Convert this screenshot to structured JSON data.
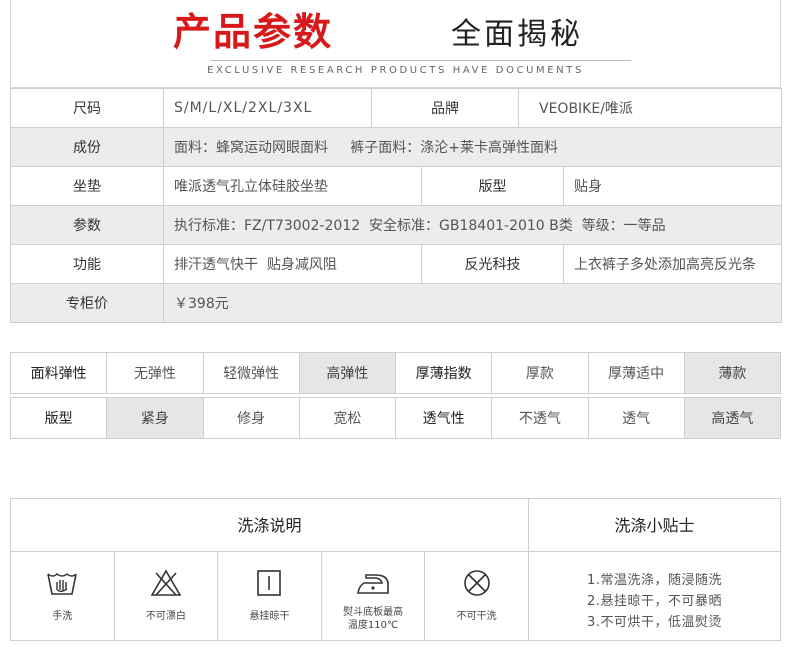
{
  "banner": {
    "title_red": "产品参数",
    "title_black": "全面揭秘",
    "subtitle": "EXCLUSIVE RESEARCH PRODUCTS HAVE DOCUMENTS"
  },
  "specs": {
    "size_label": "尺码",
    "size_value": "S/M/L/XL/2XL/3XL",
    "brand_label": "品牌",
    "brand_value": "VEOBIKE/唯派",
    "material_label": "成份",
    "material_value": "面料：蜂窝运动网眼面料     裤子面料：涤沦+莱卡高弹性面料",
    "pad_label": "坐垫",
    "pad_value": "唯派透气孔立体硅胶坐垫",
    "fit_label": "版型",
    "fit_value": "贴身",
    "params_label": "参数",
    "params_value": "执行标准：FZ/T73002-2012  安全标准：GB18401-2010 B类  等级：一等品",
    "function_label": "功能",
    "function_value": "排汗透气快干  贴身减风阻",
    "reflect_label": "反光科技",
    "reflect_value": "上衣裤子多处添加高亮反光条",
    "price_label": "专柜价",
    "price_value": "￥398元"
  },
  "attributes": {
    "row1": [
      "面料弹性",
      "无弹性",
      "轻微弹性",
      "高弹性",
      "厚薄指数",
      "厚款",
      "厚薄适中",
      "薄款"
    ],
    "row2": [
      "版型",
      "紧身",
      "修身",
      "宽松",
      "透气性",
      "不透气",
      "透气",
      "高透气"
    ]
  },
  "wash": {
    "title": "洗涤说明",
    "tips_title": "洗涤小贴士",
    "icons": [
      {
        "icon": "hand-wash-icon",
        "label": "手洗"
      },
      {
        "icon": "no-bleach-icon",
        "label": "不可漂白"
      },
      {
        "icon": "hang-dry-icon",
        "label": "悬挂晾干"
      },
      {
        "icon": "iron-icon",
        "label": "熨斗底板最高",
        "label2": "温度110℃"
      },
      {
        "icon": "no-dry-clean-icon",
        "label": "不可干洗"
      }
    ],
    "tips": [
      "1.常温洗涤，随浸随洗",
      "2.悬挂晾干，不可暴晒",
      "3.不可烘干，低温熨烫"
    ]
  }
}
